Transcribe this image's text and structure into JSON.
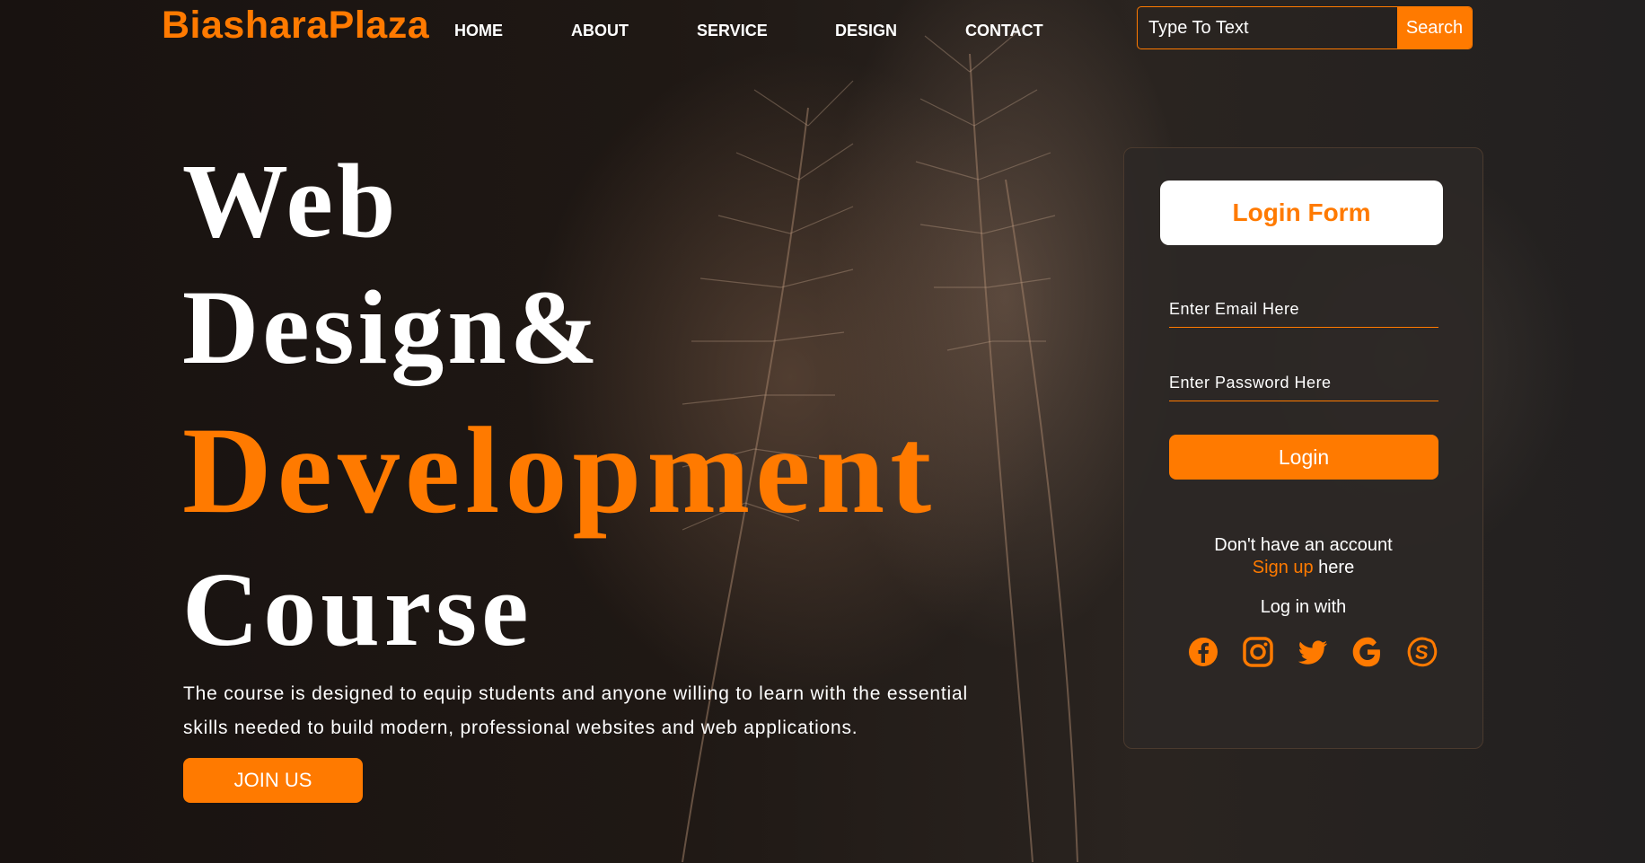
{
  "header": {
    "logo": "BiasharaPlaza",
    "nav": [
      "HOME",
      "ABOUT",
      "SERVICE",
      "DESIGN",
      "CONTACT"
    ],
    "search": {
      "placeholder": "Type To Text",
      "button_label": "Search"
    }
  },
  "hero": {
    "line1": "Web",
    "line2": "Design&",
    "line3": "Development",
    "line4": "Course",
    "description": "The course is designed to equip students and anyone willing to learn with the essential skills needed to build modern, professional websites and web applications.",
    "cta_label": "JOIN US"
  },
  "login": {
    "title": "Login Form",
    "email_placeholder": "Enter Email Here",
    "password_placeholder": "Enter Password Here",
    "button_label": "Login",
    "no_account": "Don't have an account",
    "signup_link": "Sign up",
    "signup_suffix": " here",
    "login_with": "Log in with",
    "socials": [
      "facebook-icon",
      "instagram-icon",
      "twitter-icon",
      "google-icon",
      "skype-icon"
    ]
  },
  "colors": {
    "accent": "#ff7a00",
    "text": "#ffffff",
    "background": "#1b1512"
  }
}
